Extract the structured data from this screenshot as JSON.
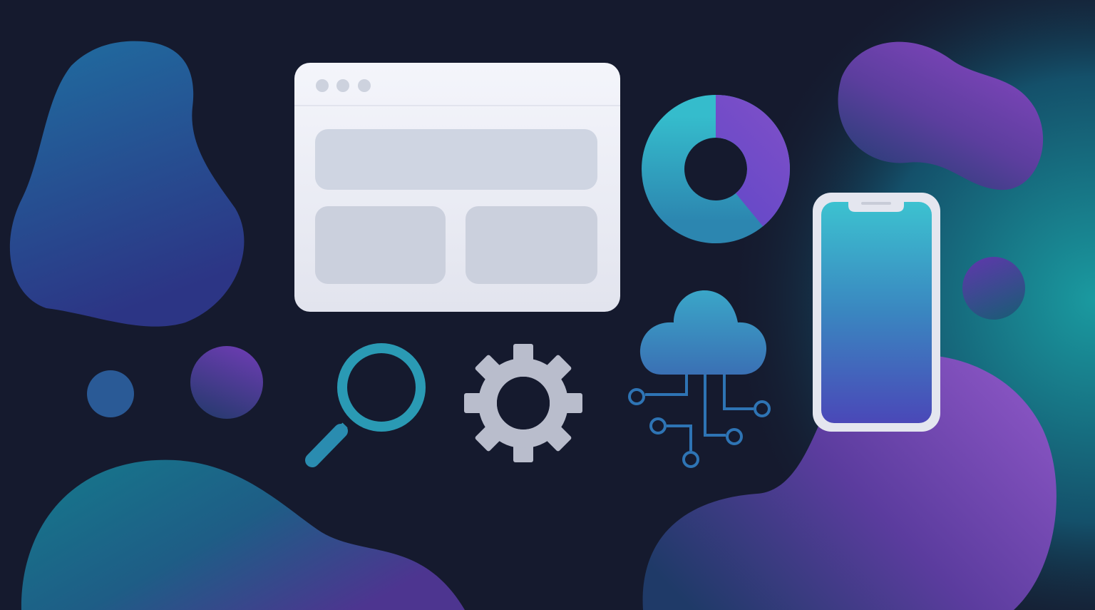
{
  "colors": {
    "background": "#151a2e",
    "teal": "#2a9ab0",
    "purple": "#7b48c4",
    "blue": "#2a5e9a",
    "window_bg": "#eef0f7",
    "panel": "#cfd5e2",
    "gear": "#b9bdcc"
  },
  "icons": {
    "window": "browser-window-icon",
    "donut": "donut-chart-icon",
    "phone": "smartphone-icon",
    "search": "magnifier-icon",
    "gear": "gear-icon",
    "cloud": "cloud-network-icon"
  },
  "donut": {
    "purple_fraction": 0.39
  }
}
